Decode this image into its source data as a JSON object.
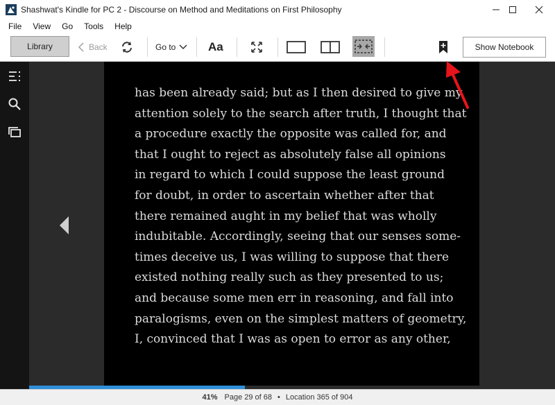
{
  "window": {
    "title": "Shashwat's Kindle for PC 2 - Discourse on Method and Meditations on First Philosophy",
    "controls": [
      "minimize",
      "maximize",
      "close"
    ]
  },
  "menu": {
    "items": [
      {
        "label": "File"
      },
      {
        "label": "View"
      },
      {
        "label": "Go"
      },
      {
        "label": "Tools"
      },
      {
        "label": "Help"
      }
    ]
  },
  "toolbar": {
    "library_label": "Library",
    "back_label": "Back",
    "goto_label": "Go to",
    "font_label": "Aa",
    "show_notebook_label": "Show Notebook"
  },
  "book": {
    "lines": [
      "has been already said; but as I then desired to give my",
      "attention solely to the search after truth, I thought that",
      "a procedure exactly the opposite was called for, and",
      "that I ought to reject as absolutely false all opinions",
      "in regard to which I could suppose the least ground",
      "for doubt, in order to ascertain whether after that",
      "there remained aught in my belief that was wholly",
      "indubitable. Accordingly, seeing that our senses some-",
      "times deceive us, I was willing to suppose that there",
      "existed nothing really such as they presented to us;",
      "and because some men err in reasoning, and fall into",
      "paralogisms, even on the simplest matters of geometry,",
      "I, convinced that I was as open to error as any other,"
    ]
  },
  "status": {
    "percent": "41%",
    "page": "Page 29 of 68",
    "location": "Location 365 of 904",
    "progress_fraction": 0.41
  },
  "colors": {
    "accent": "#2f8fd8",
    "page_bg": "#000000",
    "reader_bg": "#2b2b2b",
    "annotation": "#e8141c"
  },
  "icons": {
    "app": "kindle-icon",
    "back": "chevron-left-icon",
    "sync": "sync-icon",
    "goto": "chevron-down-icon",
    "fullscreen": "fullscreen-icon",
    "single_page": "single-column-icon",
    "two_page": "two-column-icon",
    "fit_width": "fit-width-icon",
    "bookmark": "bookmark-add-icon",
    "toc": "table-of-contents-icon",
    "search": "search-icon",
    "flashcards": "cards-icon",
    "prev": "prev-page-icon"
  }
}
